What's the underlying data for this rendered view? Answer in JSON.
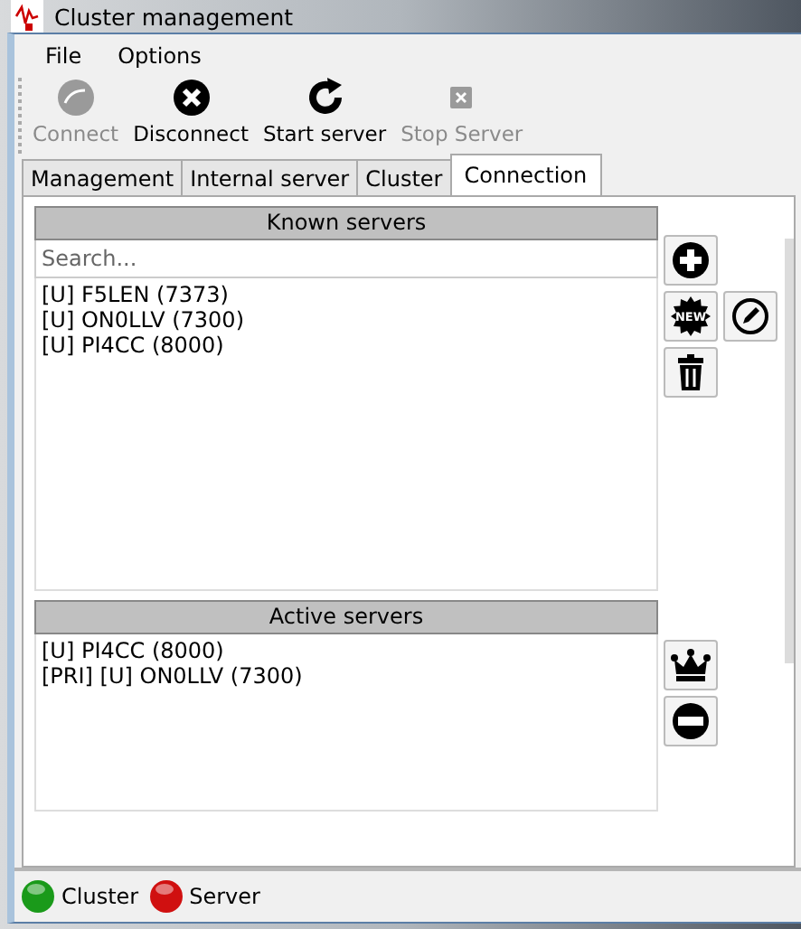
{
  "window": {
    "title": "Cluster management"
  },
  "menu": [
    "File",
    "Options"
  ],
  "toolbar": [
    {
      "label": "Connect",
      "kind": "connect",
      "disabled": true
    },
    {
      "label": "Disconnect",
      "kind": "disconnect",
      "disabled": false
    },
    {
      "label": "Start server",
      "kind": "start",
      "disabled": false
    },
    {
      "label": "Stop Server",
      "kind": "stop",
      "disabled": true
    }
  ],
  "tabs": [
    {
      "label": "Management",
      "selected": false
    },
    {
      "label": "Internal server",
      "selected": false
    },
    {
      "label": "Cluster",
      "selected": false
    },
    {
      "label": "Connection",
      "selected": true
    }
  ],
  "known_servers": {
    "title": "Known servers",
    "search": {
      "placeholder": "Search..."
    },
    "items": [
      "[U] F5LEN (7373)",
      "[U] ON0LLV (7300)",
      "[U] PI4CC (8000)"
    ],
    "buttons": [
      {
        "kind": "add"
      },
      {
        "kind": "new",
        "text": "NEW"
      },
      {
        "kind": "edit"
      },
      {
        "kind": "delete"
      }
    ]
  },
  "active_servers": {
    "title": "Active servers",
    "items": [
      "[U] PI4CC (8000)",
      "[PRI] [U] ON0LLV (7300)"
    ],
    "buttons": [
      {
        "kind": "crown"
      },
      {
        "kind": "remove"
      }
    ]
  },
  "status_bar": [
    {
      "label": "Cluster",
      "color": "#1a9a1a"
    },
    {
      "label": "Server",
      "color": "#d01010"
    }
  ]
}
